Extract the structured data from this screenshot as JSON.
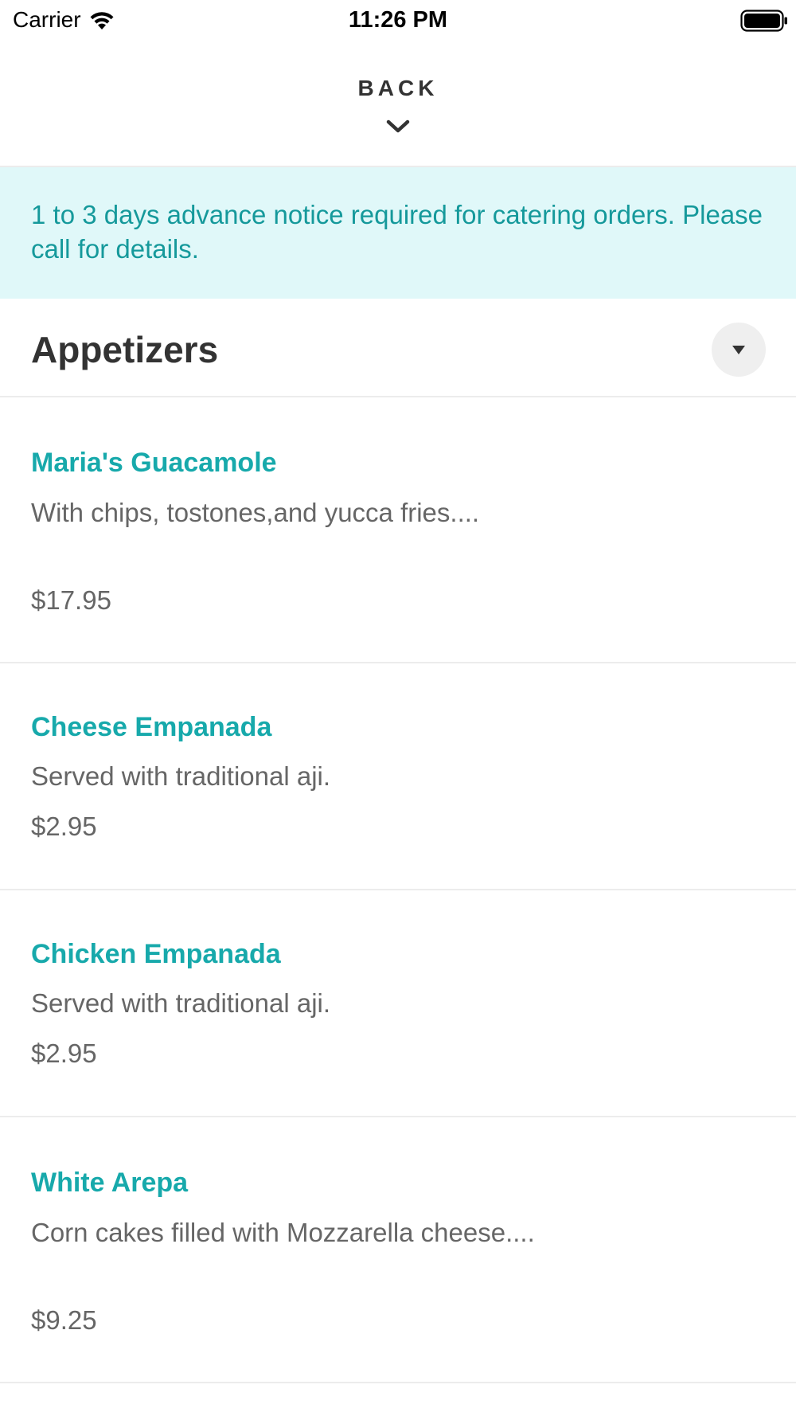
{
  "status_bar": {
    "carrier": "Carrier",
    "time": "11:26 PM",
    "wifi_icon": "wifi-icon",
    "battery_icon": "battery-full-icon"
  },
  "header": {
    "back_label": "BACK",
    "back_icon": "chevron-down-icon"
  },
  "notice": {
    "text": "1 to 3 days advance notice required for catering orders. Please call for details.",
    "background_color": "#e0f8f9",
    "text_color": "#15999b"
  },
  "category": {
    "title": "Appetizers",
    "toggle_icon": "caret-down-icon"
  },
  "accent_color": "#17a9ab",
  "menu_items": [
    {
      "name": "Maria's Guacamole",
      "description": "With chips, tostones,and yucca fries....",
      "price": "$17.95"
    },
    {
      "name": "Cheese Empanada",
      "description": "Served with traditional aji.",
      "price": "$2.95"
    },
    {
      "name": "Chicken Empanada",
      "description": "Served with traditional aji.",
      "price": "$2.95"
    },
    {
      "name": "White Arepa",
      "description": "Corn cakes filled with Mozzarella cheese....",
      "price": "$9.25"
    }
  ]
}
